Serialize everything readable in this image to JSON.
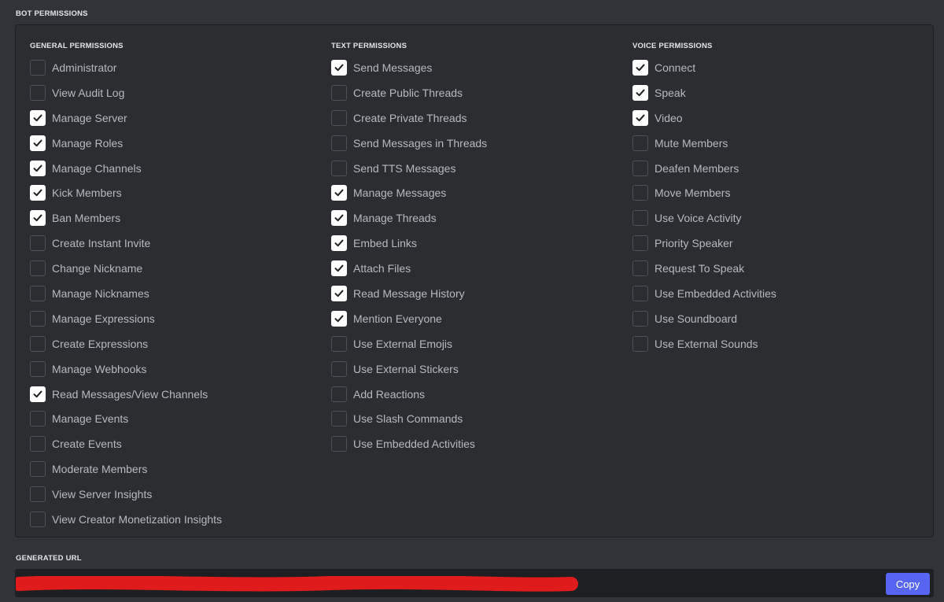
{
  "bot_permissions_title": "BOT PERMISSIONS",
  "generated_url_title": "GENERATED URL",
  "columns": [
    {
      "header": "GENERAL PERMISSIONS",
      "items": [
        {
          "label": "Administrator",
          "checked": false
        },
        {
          "label": "View Audit Log",
          "checked": false
        },
        {
          "label": "Manage Server",
          "checked": true
        },
        {
          "label": "Manage Roles",
          "checked": true
        },
        {
          "label": "Manage Channels",
          "checked": true
        },
        {
          "label": "Kick Members",
          "checked": true
        },
        {
          "label": "Ban Members",
          "checked": true
        },
        {
          "label": "Create Instant Invite",
          "checked": false
        },
        {
          "label": "Change Nickname",
          "checked": false
        },
        {
          "label": "Manage Nicknames",
          "checked": false
        },
        {
          "label": "Manage Expressions",
          "checked": false
        },
        {
          "label": "Create Expressions",
          "checked": false
        },
        {
          "label": "Manage Webhooks",
          "checked": false
        },
        {
          "label": "Read Messages/View Channels",
          "checked": true
        },
        {
          "label": "Manage Events",
          "checked": false
        },
        {
          "label": "Create Events",
          "checked": false
        },
        {
          "label": "Moderate Members",
          "checked": false
        },
        {
          "label": "View Server Insights",
          "checked": false
        },
        {
          "label": "View Creator Monetization Insights",
          "checked": false
        }
      ]
    },
    {
      "header": "TEXT PERMISSIONS",
      "items": [
        {
          "label": "Send Messages",
          "checked": true
        },
        {
          "label": "Create Public Threads",
          "checked": false
        },
        {
          "label": "Create Private Threads",
          "checked": false
        },
        {
          "label": "Send Messages in Threads",
          "checked": false
        },
        {
          "label": "Send TTS Messages",
          "checked": false
        },
        {
          "label": "Manage Messages",
          "checked": true
        },
        {
          "label": "Manage Threads",
          "checked": true
        },
        {
          "label": "Embed Links",
          "checked": true
        },
        {
          "label": "Attach Files",
          "checked": true
        },
        {
          "label": "Read Message History",
          "checked": true
        },
        {
          "label": "Mention Everyone",
          "checked": true
        },
        {
          "label": "Use External Emojis",
          "checked": false
        },
        {
          "label": "Use External Stickers",
          "checked": false
        },
        {
          "label": "Add Reactions",
          "checked": false
        },
        {
          "label": "Use Slash Commands",
          "checked": false
        },
        {
          "label": "Use Embedded Activities",
          "checked": false
        }
      ]
    },
    {
      "header": "VOICE PERMISSIONS",
      "items": [
        {
          "label": "Connect",
          "checked": true
        },
        {
          "label": "Speak",
          "checked": true
        },
        {
          "label": "Video",
          "checked": true
        },
        {
          "label": "Mute Members",
          "checked": false
        },
        {
          "label": "Deafen Members",
          "checked": false
        },
        {
          "label": "Move Members",
          "checked": false
        },
        {
          "label": "Use Voice Activity",
          "checked": false
        },
        {
          "label": "Priority Speaker",
          "checked": false
        },
        {
          "label": "Request To Speak",
          "checked": false
        },
        {
          "label": "Use Embedded Activities",
          "checked": false
        },
        {
          "label": "Use Soundboard",
          "checked": false
        },
        {
          "label": "Use External Sounds",
          "checked": false
        }
      ]
    }
  ],
  "url": {
    "value": "",
    "redaction_color": "#e01b1b"
  },
  "copy_label": "Copy",
  "colors": {
    "accent": "#5865f2",
    "panel_bg": "#2b2d31",
    "page_bg": "#313338"
  }
}
